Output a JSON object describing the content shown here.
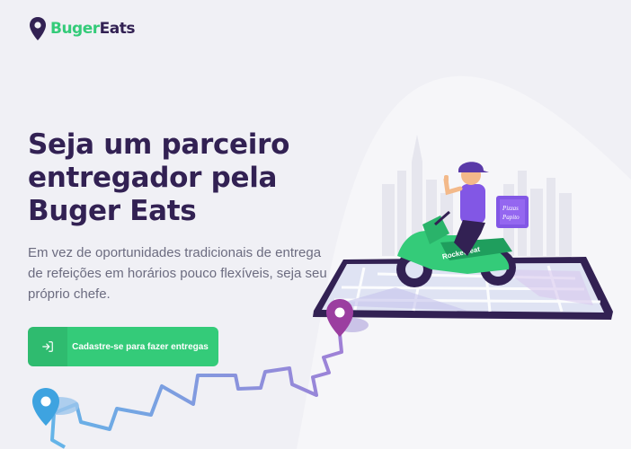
{
  "brand": {
    "name_part1": "Buger",
    "name_part2": "Eats"
  },
  "hero": {
    "title": "Seja um parceiro entregador pela Buger Eats",
    "description": "Em vez de oportunidades tradicionais de entrega de refeições em horários pouco flexíveis, seja seu próprio chefe."
  },
  "cta": {
    "label": "Cadastre-se para fazer entregas",
    "icon": "log-in-icon"
  },
  "illustration": {
    "scooter_brand": "Rocketseat",
    "box_text_line1": "Pizzas",
    "box_text_line2": "Papito"
  },
  "colors": {
    "primary": "#34cb79",
    "dark": "#322153",
    "text": "#6c6c80",
    "background": "#f0f0f5",
    "pin_purple": "#9b3ea0",
    "pin_blue": "#3ea3e0"
  }
}
